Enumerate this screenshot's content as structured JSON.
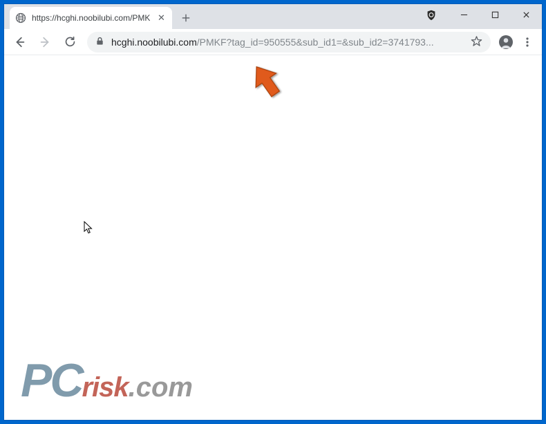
{
  "tab": {
    "title": "https://hcghi.noobilubi.com/PMK",
    "favicon_name": "globe-icon"
  },
  "window_controls": {
    "minimize_symbol": "—",
    "maximize_symbol": "□",
    "close_symbol": "✕"
  },
  "toolbar": {
    "newtab_symbol": "+",
    "tab_close_symbol": "✕"
  },
  "omnibox": {
    "lock_name": "lock-icon",
    "url_domain": "hcghi.noobilubi.com",
    "url_path": "/PMKF?tag_id=950555&sub_id1=&sub_id2=3741793...",
    "star_symbol": "☆"
  },
  "watermark": {
    "pc": "PC",
    "risk": "risk",
    "dotcom": ".com"
  }
}
